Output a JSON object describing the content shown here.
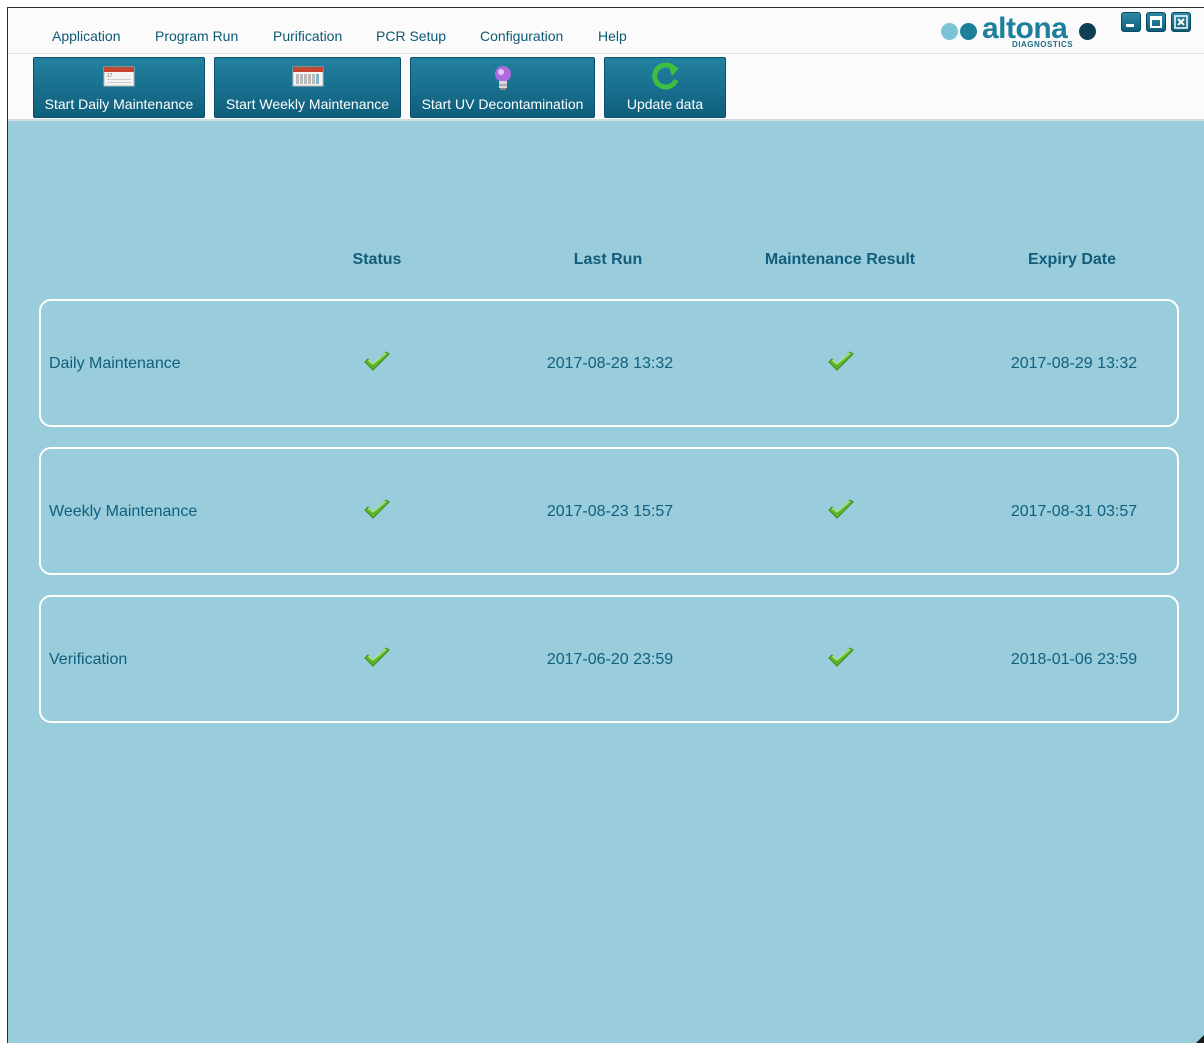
{
  "menu": {
    "items": [
      "Application",
      "Program Run",
      "Purification",
      "PCR Setup",
      "Configuration",
      "Help"
    ]
  },
  "brand": {
    "name": "altona",
    "subtitle": "DIAGNOSTICS",
    "colors": {
      "light_dot": "#7cc3d6",
      "dark_dot": "#1e7f9c",
      "end_dot": "#0e3f56"
    }
  },
  "window_controls": {
    "minimize_icon": "minimize-icon",
    "maximize_icon": "maximize-icon",
    "close_icon": "close-icon"
  },
  "toolbar": {
    "buttons": [
      {
        "label": "Start Daily Maintenance",
        "icon": "calendar-icon"
      },
      {
        "label": "Start Weekly Maintenance",
        "icon": "calendar-week-icon"
      },
      {
        "label": "Start UV Decontamination",
        "icon": "uv-bulb-icon"
      },
      {
        "label": "Update data",
        "icon": "refresh-icon"
      }
    ]
  },
  "table": {
    "headers": [
      "Status",
      "Last Run",
      "Maintenance Result",
      "Expiry Date"
    ],
    "rows": [
      {
        "name": "Daily Maintenance",
        "status": "ok",
        "last_run": "2017-08-28 13:32",
        "result": "ok",
        "expiry": "2017-08-29 13:32"
      },
      {
        "name": "Weekly Maintenance",
        "status": "ok",
        "last_run": "2017-08-23 15:57",
        "result": "ok",
        "expiry": "2017-08-31 03:57"
      },
      {
        "name": "Verification",
        "status": "ok",
        "last_run": "2017-06-20 23:59",
        "result": "ok",
        "expiry": "2018-01-06 23:59"
      }
    ]
  },
  "colors": {
    "background": "#9acddb",
    "accent": "#0e5f7c",
    "text": "#0f5f7e",
    "check": "#5cb82e"
  }
}
